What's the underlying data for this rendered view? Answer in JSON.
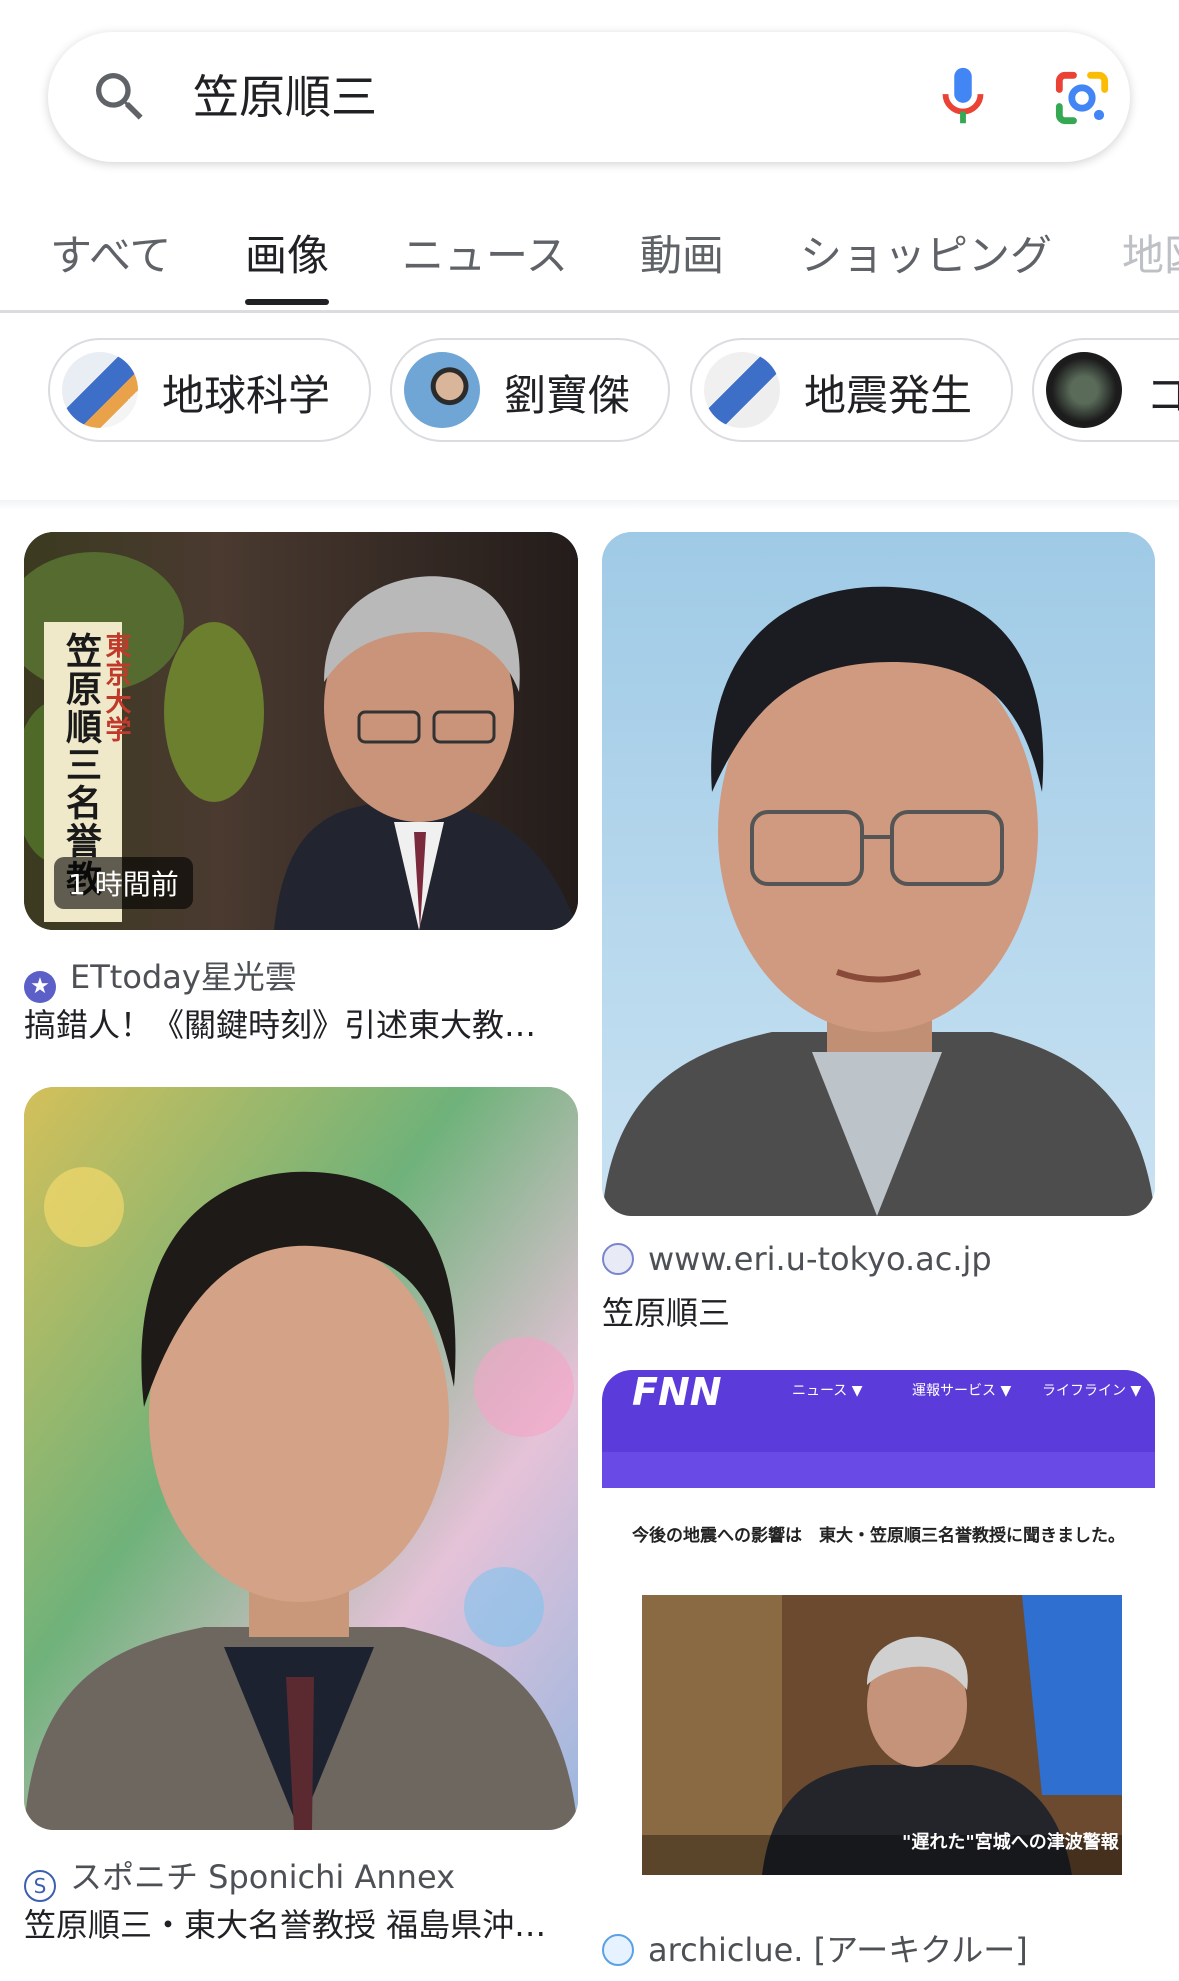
{
  "search": {
    "query": "笠原順三"
  },
  "tabs": [
    {
      "label": "すべて"
    },
    {
      "label": "画像"
    },
    {
      "label": "ニュース"
    },
    {
      "label": "動画"
    },
    {
      "label": "ショッピング"
    },
    {
      "label": "地図"
    }
  ],
  "chips": [
    {
      "label": "地球科学"
    },
    {
      "label": "劉寶傑"
    },
    {
      "label": "地震発生"
    },
    {
      "label": "コ"
    }
  ],
  "results": [
    {
      "badge": "1 時間前",
      "overlay_org": "東京大学",
      "overlay_name": "笠原順三名誉教",
      "source": "ETtoday星光雲",
      "caption": "搞錯人！《關鍵時刻》引述東大教…"
    },
    {
      "source": "www.eri.u-tokyo.ac.jp",
      "caption": "笠原順三"
    },
    {
      "source": "スポニチ Sponichi Annex",
      "caption": "笠原順三・東大名誉教授 福島県沖…"
    },
    {
      "site_logo": "FNN",
      "nav": [
        "ニュース ▼",
        "運報サービス ▼",
        "ライフライン ▼"
      ],
      "headline": "今後の地震への影響は　東大・笠原順三名誉教授に聞きました。",
      "ticker": "\"遅れた\"宮城への津波警報",
      "source": "archiclue. [アーキクルー]"
    }
  ],
  "colors": {
    "accent": "#202124",
    "muted": "#5f6368",
    "fnn_purple": "#5b3bd9"
  }
}
